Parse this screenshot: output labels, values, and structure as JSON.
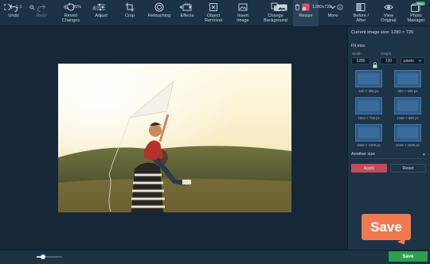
{
  "toolbar": {
    "undo": "Undo",
    "redo": "Redo",
    "revert": "Revert\nChanges",
    "adjust": "Adjust",
    "crop": "Crop",
    "retouching": "Retouching",
    "effects": "Effects",
    "object_removal": "Object\nRemoval",
    "insert_image": "Insert\nImage",
    "change_background": "Change\nBackground",
    "resize": "Resize",
    "more": "More",
    "before_after": "Before /\nAfter",
    "view_original": "View\nOriginal",
    "photo_manager": "Photo\nManager",
    "new_badge": "New"
  },
  "panel": {
    "current_size_label": "Current image size: 1280 × 720",
    "fit_into_label": "Fit into:",
    "width_label": "Width",
    "height_label": "Height",
    "width_value": "1280",
    "height_value": "720",
    "unit": "pixels",
    "presets": [
      "640 × 480 px",
      "800 × 600 px",
      "1024 × 768 px",
      "1280 × 960 px",
      "1920 × 1200 px",
      "2048 × 1536 px"
    ],
    "another_size": "Another size",
    "apply": "Apply",
    "reset": "Reset"
  },
  "callout": {
    "save": "Save"
  },
  "bottom": {
    "ratio": "1:1",
    "zoom": "25%",
    "image_size": "1280x720",
    "save": "Save"
  },
  "colors": {
    "accent_resize": "#2c4258",
    "apply": "#c44a5c",
    "save": "#2e9e4f",
    "callout": "#ef7a52"
  },
  "zoom_slider": {
    "level": 0.25
  }
}
